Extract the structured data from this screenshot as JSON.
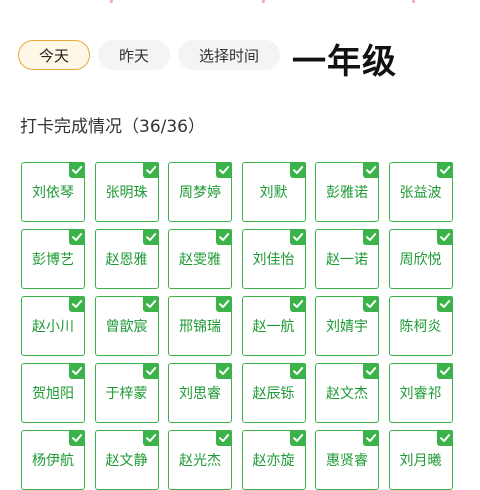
{
  "tabs": [
    {
      "label": "今天",
      "active": true
    },
    {
      "label": "昨天",
      "active": false
    },
    {
      "label": "选择时间",
      "active": false
    }
  ],
  "grade_title": "一年级",
  "summary": "打卡完成情况（36/36）",
  "status_icon": "checkmark-icon",
  "colors": {
    "accent": "#3bb34a",
    "name_text": "#1e9a35",
    "active_tab_border": "#e6a93a",
    "active_tab_bg": "#fef7e6"
  },
  "students": [
    "刘依琴",
    "张明珠",
    "周梦婷",
    "刘默",
    "彭雅诺",
    "张益波",
    "彭博艺",
    "赵恩雅",
    "赵雯雅",
    "刘佳怡",
    "赵一诺",
    "周欣悦",
    "赵小川",
    "曾歆宸",
    "邢锦瑞",
    "赵一航",
    "刘婧宇",
    "陈柯炎",
    "贺旭阳",
    "于梓蒙",
    "刘思睿",
    "赵辰铄",
    "赵文杰",
    "刘睿祁",
    "杨伊航",
    "赵文静",
    "赵光杰",
    "赵亦旋",
    "惠贤睿",
    "刘月曦"
  ]
}
